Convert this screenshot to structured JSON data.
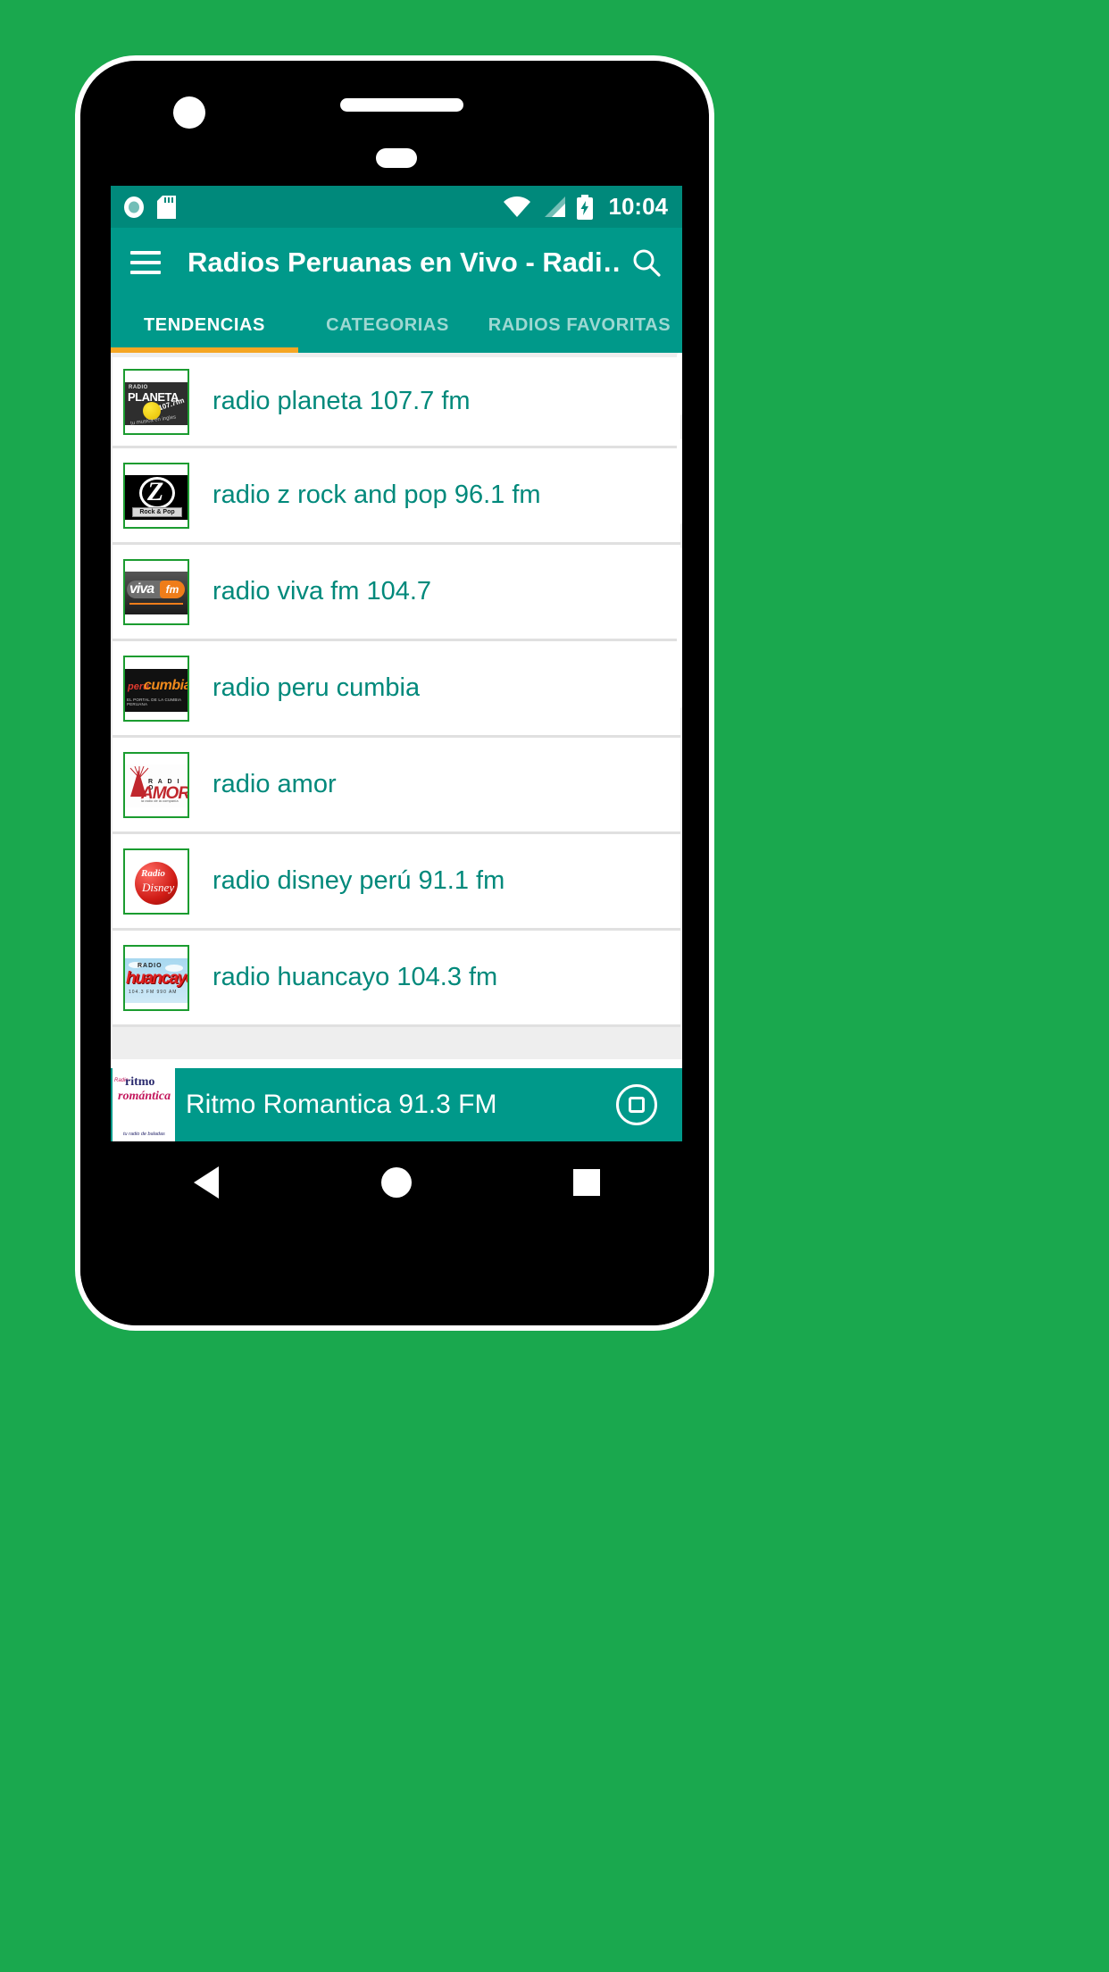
{
  "theme": {
    "background": "#1aa84e",
    "status_bar_bg": "#00897b",
    "app_bar_bg": "#00998a",
    "accent_indicator": "#f5a623",
    "station_text": "#00897b",
    "thumb_border": "#1b9c30"
  },
  "status_bar": {
    "clock": "10:04",
    "icons": [
      "record-icon",
      "sd-card-icon",
      "wifi-icon",
      "cell-signal-icon",
      "battery-charging-icon"
    ]
  },
  "app_bar": {
    "menu_icon": "hamburger-menu-icon",
    "title": "Radios Peruanas en Vivo - Radi…",
    "search_icon": "search-icon"
  },
  "tabs": [
    {
      "label": "TENDENCIAS",
      "active": true
    },
    {
      "label": "CATEGORIAS",
      "active": false
    },
    {
      "label": "RADIOS FAVORITAS",
      "active": false
    }
  ],
  "stations": [
    {
      "name": "radio planeta 107.7 fm",
      "logo": {
        "id": "radio-planeta-logo",
        "radio_word": "RADIO",
        "brand": "PLANETA",
        "frequency": "107.7fm",
        "tagline": "tu musica en ingles"
      }
    },
    {
      "name": "radio z rock and pop 96.1 fm",
      "logo": {
        "id": "radio-z-rock-and-pop-logo",
        "letter": "Z",
        "tagline": "Rock & Pop"
      }
    },
    {
      "name": "radio viva fm 104.7",
      "logo": {
        "id": "radio-viva-fm-logo",
        "brand": "viva",
        "suffix": "fm"
      }
    },
    {
      "name": "radio peru cumbia",
      "logo": {
        "id": "radio-peru-cumbia-logo",
        "brand_first": "peru",
        "brand_second": "cumbia",
        "tagline": "EL PORTAL DE LA CUMBIA PERUANA"
      }
    },
    {
      "name": "radio amor",
      "logo": {
        "id": "radio-amor-logo",
        "radio_word": "R A D I O",
        "brand": "AMOR",
        "tagline": "la radio de la companía"
      }
    },
    {
      "name": "radio disney perú 91.1 fm",
      "logo": {
        "id": "radio-disney-logo",
        "radio_word": "Radio",
        "brand": "Disney"
      }
    },
    {
      "name": "radio huancayo 104.3 fm",
      "logo": {
        "id": "radio-huancayo-logo",
        "radio_word": "RADIO",
        "brand": "huancayo",
        "tagline": "104.3 FM  990 AM"
      }
    }
  ],
  "player": {
    "now_playing": "Ritmo Romantica 91.3 FM",
    "stop_icon": "stop-button-icon",
    "logo": {
      "id": "ritmo-romantica-logo",
      "radio_word": "Radio",
      "brand_first": "ritmo",
      "brand_second": "romántica",
      "tagline": "tu radio de baladas"
    }
  },
  "nav_bar": {
    "back": "back-triangle-icon",
    "home": "home-circle-icon",
    "recents": "recents-square-icon"
  }
}
